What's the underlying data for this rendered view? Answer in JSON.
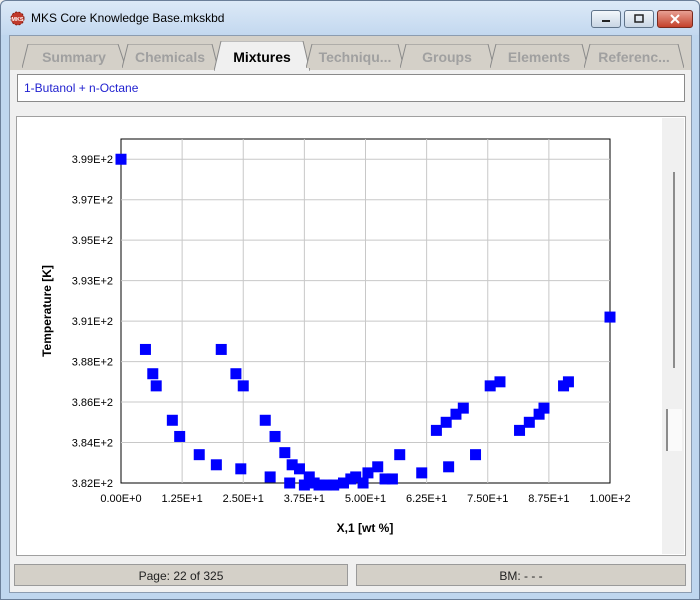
{
  "window": {
    "title": "MKS Core Knowledge Base.mkskbd",
    "icon": "mks-logo-icon",
    "controls": [
      "minimize-icon",
      "maximize-icon",
      "close-icon"
    ]
  },
  "tabs": [
    {
      "label": "Summary",
      "active": false
    },
    {
      "label": "Chemicals",
      "active": false
    },
    {
      "label": "Mixtures",
      "active": true
    },
    {
      "label": "Techniqu...",
      "active": false
    },
    {
      "label": "Groups",
      "active": false
    },
    {
      "label": "Elements",
      "active": false
    },
    {
      "label": "Referenc...",
      "active": false
    }
  ],
  "mixture_name": "1-Butanol + n-Octane",
  "chart_data": {
    "type": "scatter",
    "xlabel": "X,1 [wt %]",
    "ylabel": "Temperature [K]",
    "xlim": [
      0,
      100
    ],
    "ylim": [
      382,
      399
    ],
    "grid": true,
    "marker": "square",
    "marker_color": "#0000ff",
    "xticks": [
      0,
      12.5,
      25,
      37.5,
      50,
      62.5,
      75,
      87.5,
      100
    ],
    "xtick_labels": [
      "0.00E+0",
      "1.25E+1",
      "2.50E+1",
      "3.75E+1",
      "5.00E+1",
      "6.25E+1",
      "7.50E+1",
      "8.75E+1",
      "1.00E+2"
    ],
    "yticks": [
      382,
      384,
      386,
      388,
      390,
      392,
      394,
      396,
      398
    ],
    "ytick_labels": [
      "3.82E+2",
      "3.84E+2",
      "3.86E+2",
      "3.88E+2",
      "3.91E+2",
      "3.93E+2",
      "3.95E+2",
      "3.97E+2",
      "3.99E+2"
    ],
    "points": [
      {
        "x": 0.0,
        "y": 398.0
      },
      {
        "x": 5.0,
        "y": 388.6
      },
      {
        "x": 6.5,
        "y": 387.4
      },
      {
        "x": 7.2,
        "y": 386.8
      },
      {
        "x": 10.5,
        "y": 385.1
      },
      {
        "x": 12.0,
        "y": 384.3
      },
      {
        "x": 16.0,
        "y": 383.4
      },
      {
        "x": 19.5,
        "y": 382.9
      },
      {
        "x": 20.5,
        "y": 388.6
      },
      {
        "x": 23.5,
        "y": 387.4
      },
      {
        "x": 24.5,
        "y": 382.7
      },
      {
        "x": 25.0,
        "y": 386.8
      },
      {
        "x": 29.5,
        "y": 385.1
      },
      {
        "x": 30.5,
        "y": 382.3
      },
      {
        "x": 31.5,
        "y": 384.3
      },
      {
        "x": 33.5,
        "y": 383.5
      },
      {
        "x": 34.5,
        "y": 382.0
      },
      {
        "x": 35.0,
        "y": 382.9
      },
      {
        "x": 36.5,
        "y": 382.7
      },
      {
        "x": 37.5,
        "y": 381.9
      },
      {
        "x": 38.5,
        "y": 382.3
      },
      {
        "x": 39.5,
        "y": 382.0
      },
      {
        "x": 40.5,
        "y": 381.9
      },
      {
        "x": 42.0,
        "y": 381.9
      },
      {
        "x": 43.5,
        "y": 381.9
      },
      {
        "x": 45.5,
        "y": 382.0
      },
      {
        "x": 47.0,
        "y": 382.2
      },
      {
        "x": 48.0,
        "y": 382.3
      },
      {
        "x": 49.5,
        "y": 382.0
      },
      {
        "x": 50.5,
        "y": 382.5
      },
      {
        "x": 52.5,
        "y": 382.8
      },
      {
        "x": 54.0,
        "y": 382.2
      },
      {
        "x": 55.5,
        "y": 382.2
      },
      {
        "x": 57.0,
        "y": 383.4
      },
      {
        "x": 61.5,
        "y": 382.5
      },
      {
        "x": 64.5,
        "y": 384.6
      },
      {
        "x": 66.5,
        "y": 385.0
      },
      {
        "x": 67.0,
        "y": 382.8
      },
      {
        "x": 68.5,
        "y": 385.4
      },
      {
        "x": 70.0,
        "y": 385.7
      },
      {
        "x": 72.5,
        "y": 383.4
      },
      {
        "x": 75.5,
        "y": 386.8
      },
      {
        "x": 77.5,
        "y": 387.0
      },
      {
        "x": 81.5,
        "y": 384.6
      },
      {
        "x": 83.5,
        "y": 385.0
      },
      {
        "x": 85.5,
        "y": 385.4
      },
      {
        "x": 86.5,
        "y": 385.7
      },
      {
        "x": 90.5,
        "y": 386.8
      },
      {
        "x": 91.5,
        "y": 387.0
      },
      {
        "x": 100.0,
        "y": 390.2
      }
    ]
  },
  "status": {
    "page": "Page: 22 of 325",
    "bm": "BM: - - -"
  }
}
